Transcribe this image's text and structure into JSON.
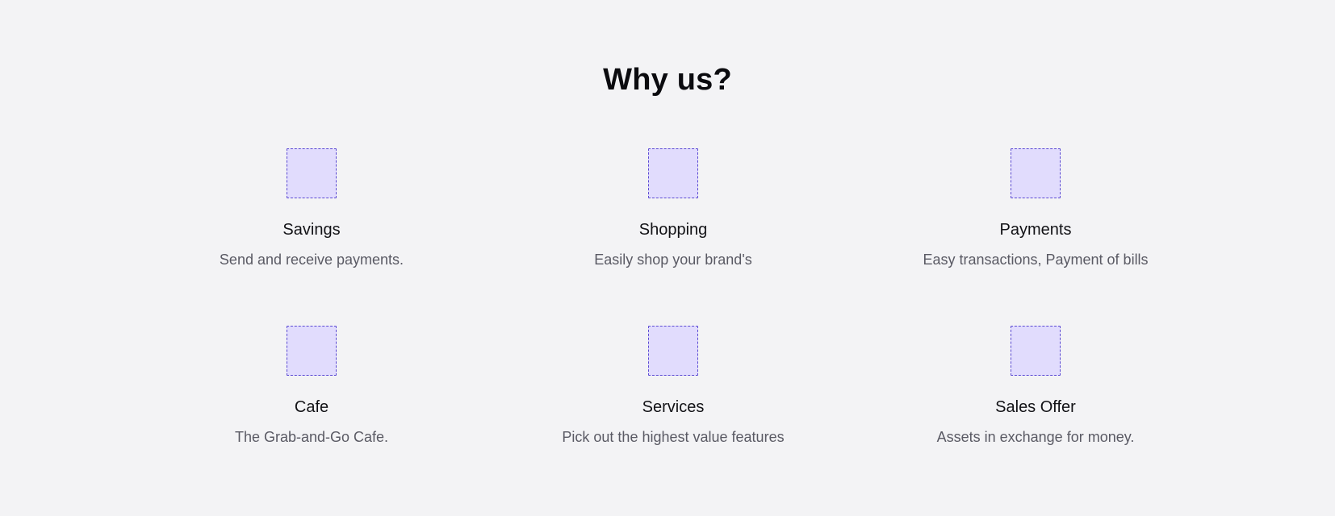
{
  "section": {
    "title": "Why us?"
  },
  "features": [
    {
      "icon": "placeholder-image-icon",
      "title": "Savings",
      "description": "Send and receive payments."
    },
    {
      "icon": "placeholder-image-icon",
      "title": "Shopping",
      "description": "Easily shop your brand's"
    },
    {
      "icon": "placeholder-image-icon",
      "title": "Payments",
      "description": "Easy transactions, Payment of bills"
    },
    {
      "icon": "placeholder-image-icon",
      "title": "Cafe",
      "description": "The Grab-and-Go Cafe."
    },
    {
      "icon": "placeholder-image-icon",
      "title": "Services",
      "description": "Pick out the highest value features"
    },
    {
      "icon": "placeholder-image-icon",
      "title": "Sales Offer",
      "description": "Assets in exchange for money."
    }
  ],
  "colors": {
    "background": "#f3f3f5",
    "icon_fill": "#e1dcfd",
    "icon_border": "#5b4ad3",
    "heading": "#0b0b0f",
    "body_text": "#5a5a64"
  }
}
